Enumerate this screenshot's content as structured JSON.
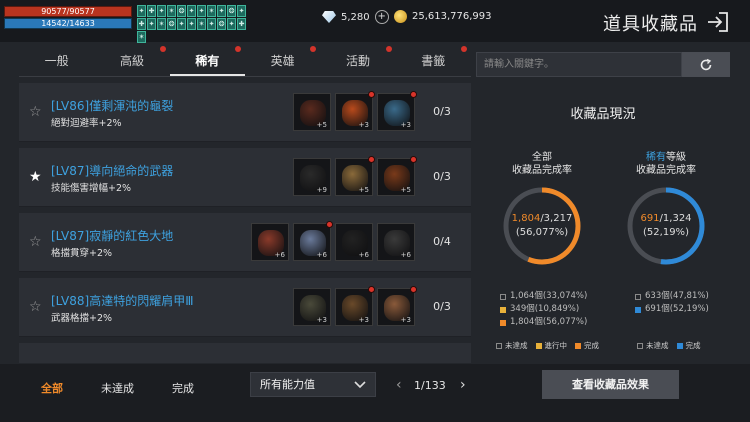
{
  "status": {
    "hp": "90577/90577",
    "mp": "14542/14633"
  },
  "buffs": [
    "✦",
    "✚",
    "✦",
    "✶",
    "❂",
    "✦",
    "✦",
    "✶",
    "✦",
    "❂",
    "✦",
    "✚",
    "✦",
    "✶",
    "❂",
    "✦",
    "✦",
    "✶",
    "✦",
    "❂",
    "✦",
    "✚",
    "✶"
  ],
  "currency": {
    "diamonds": "5,280",
    "gold": "25,613,776,993"
  },
  "page_title": "道具收藏品",
  "tabs": [
    {
      "label": "一般",
      "dot": false,
      "active": false
    },
    {
      "label": "高級",
      "dot": true,
      "active": false
    },
    {
      "label": "稀有",
      "dot": true,
      "active": true
    },
    {
      "label": "英雄",
      "dot": true,
      "active": false
    },
    {
      "label": "活動",
      "dot": true,
      "active": false
    },
    {
      "label": "書籤",
      "dot": true,
      "active": false
    }
  ],
  "search": {
    "placeholder": "請輸入關鍵字。"
  },
  "collections": [
    {
      "name": "[LV86]僅剩渾沌的龜裂",
      "effect": "絕對迴避率+2%",
      "starred": false,
      "count": "0/3",
      "items": [
        {
          "lv": "+5",
          "color": "#5a2a1e",
          "dot": false
        },
        {
          "lv": "+3",
          "color": "#b84a1c",
          "dot": true
        },
        {
          "lv": "+3",
          "color": "#3a6a8a",
          "dot": true
        }
      ]
    },
    {
      "name": "[LV87]導向絕命的武器",
      "effect": "技能傷害增幅+2%",
      "starred": true,
      "count": "0/3",
      "items": [
        {
          "lv": "+9",
          "color": "#2a2a2a",
          "dot": false
        },
        {
          "lv": "+5",
          "color": "#8a6a3a",
          "dot": true
        },
        {
          "lv": "+5",
          "color": "#7a3a1a",
          "dot": true
        }
      ]
    },
    {
      "name": "[LV87]寂靜的紅色大地",
      "effect": "格擋貫穿+2%",
      "starred": false,
      "count": "0/4",
      "items": [
        {
          "lv": "+6",
          "color": "#8a3a2a",
          "dot": false
        },
        {
          "lv": "+6",
          "color": "#6a7a9a",
          "dot": true
        },
        {
          "lv": "+6",
          "color": "#222222",
          "dot": false
        },
        {
          "lv": "+6",
          "color": "#3a3a3a",
          "dot": false
        }
      ]
    },
    {
      "name": "[LV88]高達特的閃耀肩甲Ⅲ",
      "effect": "武器格擋+2%",
      "starred": false,
      "count": "0/3",
      "items": [
        {
          "lv": "+3",
          "color": "#4a4a3a",
          "dot": false
        },
        {
          "lv": "+3",
          "color": "#6a4a2a",
          "dot": true
        },
        {
          "lv": "+3",
          "color": "#8a5a3a",
          "dot": true
        }
      ]
    }
  ],
  "panel": {
    "title": "收藏品現況",
    "total": {
      "line1": "全部",
      "line2": "收藏品完成率",
      "value": "1,804",
      "total": "/3,217",
      "pct": "(56,077%)",
      "fraction": 0.56077,
      "stats": [
        "1,064個(33,074%)",
        "349個(10,849%)",
        "1,804個(56,077%)"
      ]
    },
    "rare": {
      "line1_hl": "稀有",
      "line1_rest": "等級",
      "line2": "收藏品完成率",
      "value": "691",
      "total": "/1,324",
      "pct": "(52,19%)",
      "fraction": 0.5219,
      "stats": [
        "633個(47,81%)",
        "691個(52,19%)"
      ]
    },
    "legend_left": [
      "未達成",
      "進行中",
      "完成"
    ],
    "legend_right": [
      "未達成",
      "完成"
    ]
  },
  "colors": {
    "accent_orange": "#f08a2a",
    "accent_blue": "#2f8ad8",
    "progress_yellow": "#e8b13a"
  },
  "bottom": {
    "filters": [
      "全部",
      "未達成",
      "完成"
    ],
    "dropdown": "所有能力值",
    "page": "1/133",
    "effect_button": "查看收藏品效果"
  }
}
